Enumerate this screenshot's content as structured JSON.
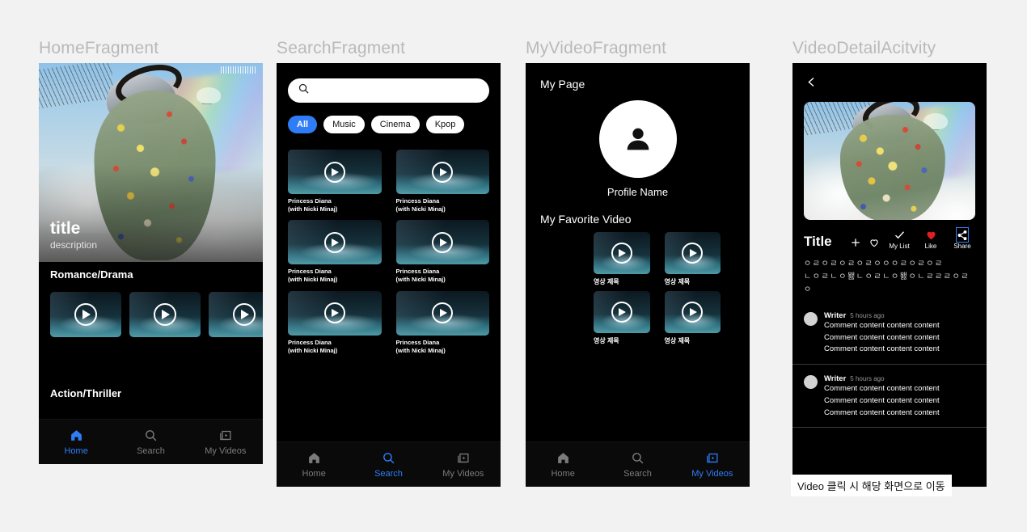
{
  "panels": {
    "home": {
      "label": "HomeFragment",
      "hero": {
        "title": "title",
        "description": "description"
      },
      "sections": [
        {
          "title": "Romance/Drama",
          "items": [
            {
              "id": "r1"
            },
            {
              "id": "r2"
            },
            {
              "id": "r3"
            }
          ]
        },
        {
          "title": "Action/Thriller",
          "items": []
        }
      ],
      "nav": [
        {
          "id": "home",
          "label": "Home",
          "icon": "home-icon",
          "active": true
        },
        {
          "id": "search",
          "label": "Search",
          "icon": "search-icon",
          "active": false
        },
        {
          "id": "myvideos",
          "label": "My Videos",
          "icon": "my-videos-icon",
          "active": false
        }
      ]
    },
    "search": {
      "label": "SearchFragment",
      "search_input": {
        "value": "",
        "placeholder": "",
        "icon": "search-icon"
      },
      "chips": [
        {
          "label": "All",
          "selected": true
        },
        {
          "label": "Music",
          "selected": false
        },
        {
          "label": "Cinema",
          "selected": false
        },
        {
          "label": "Kpop",
          "selected": false
        }
      ],
      "results": [
        {
          "line1": "Princess Diana",
          "line2": "(with Nicki Minaj)"
        },
        {
          "line1": "Princess Diana",
          "line2": "(with Nicki Minaj)"
        },
        {
          "line1": "Princess Diana",
          "line2": "(with Nicki Minaj)"
        },
        {
          "line1": "Princess Diana",
          "line2": "(with Nicki Minaj)"
        },
        {
          "line1": "Princess Diana",
          "line2": "(with Nicki Minaj)"
        },
        {
          "line1": "Princess Diana",
          "line2": "(with Nicki Minaj)"
        }
      ],
      "nav": [
        {
          "id": "home",
          "label": "Home",
          "icon": "home-icon",
          "active": false
        },
        {
          "id": "search",
          "label": "Search",
          "icon": "search-icon",
          "active": true
        },
        {
          "id": "myvideos",
          "label": "My Videos",
          "icon": "my-videos-icon",
          "active": false
        }
      ]
    },
    "myvideo": {
      "label": "MyVideoFragment",
      "page_title": "My Page",
      "profile_name": "Profile Name",
      "favorite_header": "My Favorite Video",
      "favorites": [
        {
          "title": "영상 제목"
        },
        {
          "title": "영상 제목"
        },
        {
          "title": "영상 제목"
        },
        {
          "title": "영상 제목"
        }
      ],
      "nav": [
        {
          "id": "home",
          "label": "Home",
          "icon": "home-icon",
          "active": false
        },
        {
          "id": "search",
          "label": "Search",
          "icon": "search-icon",
          "active": false
        },
        {
          "id": "myvideos",
          "label": "My Videos",
          "icon": "my-videos-icon",
          "active": true
        }
      ]
    },
    "detail": {
      "label": "VideoDetailAcitvity",
      "back_icon": "back-chevron-icon",
      "title": "Title",
      "actions": [
        {
          "id": "add",
          "icon": "plus-icon",
          "label": ""
        },
        {
          "id": "favorite",
          "icon": "heart-outline-icon",
          "label": ""
        },
        {
          "id": "mylist",
          "icon": "check-icon",
          "label": "My List"
        },
        {
          "id": "like",
          "icon": "heart-filled-icon",
          "label": "Like"
        },
        {
          "id": "share",
          "icon": "share-icon",
          "label": "Share"
        }
      ],
      "description_lines": [
        "ㅇㄹㅇㄹㅇㄹㅇㄹㅇㅇㅇㄹㅇㄹㅇㄹ",
        "ㄴㅇㄹㄴㅇ뫯ㄴㅇㄹㄴㅇ뫯ㅇㄴㄹㄹㄹㅇㄹㅇ"
      ],
      "comments": [
        {
          "writer": "Writer",
          "time": "5 hours ago",
          "lines": [
            "Comment content content content",
            "Comment content content content",
            "Comment content content content"
          ]
        },
        {
          "writer": "Writer",
          "time": "5 hours ago",
          "lines": [
            "Comment content content content",
            "Comment content content content",
            "Comment content content content"
          ]
        }
      ]
    }
  },
  "note": "Video 클릭 시 해당 화면으로 이동",
  "colors": {
    "accent": "#2f7df6",
    "like_red": "#e02020",
    "screen_bg": "#000000",
    "board_bg": "#f2f2f2",
    "label_gray": "#b9b9b9"
  }
}
